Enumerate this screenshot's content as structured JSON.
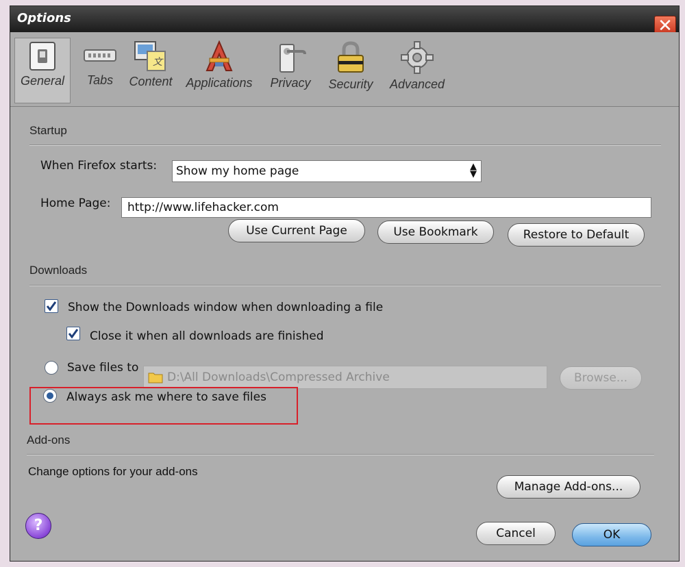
{
  "window": {
    "title": "Options",
    "close_symbol": "✕"
  },
  "tabs": [
    {
      "label": "General",
      "icon": "switch-icon",
      "selected": true
    },
    {
      "label": "Tabs",
      "icon": "tabs-icon",
      "selected": false
    },
    {
      "label": "Content",
      "icon": "content-icon",
      "selected": false
    },
    {
      "label": "Applications",
      "icon": "applications-icon",
      "selected": false
    },
    {
      "label": "Privacy",
      "icon": "privacy-icon",
      "selected": false
    },
    {
      "label": "Security",
      "icon": "lock-icon",
      "selected": false
    },
    {
      "label": "Advanced",
      "icon": "gear-icon",
      "selected": false
    }
  ],
  "startup": {
    "heading": "Startup",
    "when_label": "When Firefox starts:",
    "when_value": "Show my home page",
    "homepage_label": "Home Page:",
    "homepage_value": "http://www.lifehacker.com",
    "buttons": {
      "current": "Use Current Page",
      "bookmark": "Use Bookmark",
      "restore": "Restore to Default"
    }
  },
  "downloads": {
    "heading": "Downloads",
    "show_window": {
      "label": "Show the Downloads window when downloading a file",
      "checked": true
    },
    "close_when_done": {
      "label": "Close it when all downloads are finished",
      "checked": true
    },
    "save_to": {
      "label": "Save files to",
      "selected": false,
      "path": "D:\\All Downloads\\Compressed Archive"
    },
    "browse": "Browse...",
    "always_ask": {
      "label": "Always ask me where to save files",
      "selected": true
    }
  },
  "addons": {
    "heading": "Add-ons",
    "description": "Change options for your add-ons",
    "manage": "Manage Add-ons..."
  },
  "footer": {
    "help": "?",
    "cancel": "Cancel",
    "ok": "OK"
  },
  "colors": {
    "highlight": "#d8202a",
    "ok_button": "#7db9ea",
    "window_bg": "#aeaeae"
  }
}
